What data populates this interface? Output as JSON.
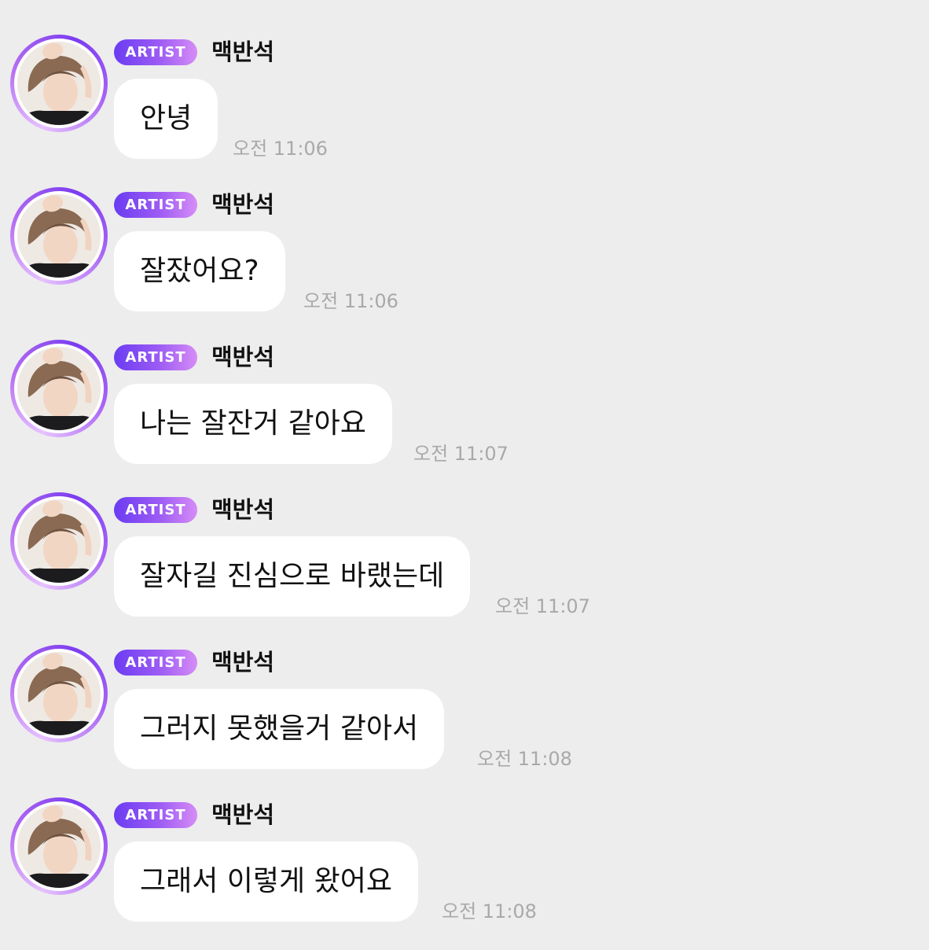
{
  "messages": [
    {
      "badge": "ARTIST",
      "sender": "맥반석",
      "text": "안녕",
      "time": "오전 11:06"
    },
    {
      "badge": "ARTIST",
      "sender": "맥반석",
      "text": "잘잤어요?",
      "time": "오전 11:06"
    },
    {
      "badge": "ARTIST",
      "sender": "맥반석",
      "text": "나는 잘잔거 같아요",
      "time": "오전 11:07"
    },
    {
      "badge": "ARTIST",
      "sender": "맥반석",
      "text": "잘자길 진심으로 바랬는데",
      "time": "오전 11:07"
    },
    {
      "badge": "ARTIST",
      "sender": "맥반석",
      "text": "그러지 못했을거 같아서",
      "time": "오전 11:08"
    },
    {
      "badge": "ARTIST",
      "sender": "맥반석",
      "text": "그래서 이렇게 왔어요",
      "time": "오전 11:08"
    }
  ],
  "colors": {
    "background": "#ededed",
    "bubble": "#ffffff",
    "badge_start": "#6a3cf2",
    "badge_end": "#d68cf6",
    "avatar_ring": "#9d5cf4",
    "timestamp": "#a9a9a9"
  },
  "icons": {
    "avatar": "artist-profile-photo"
  }
}
